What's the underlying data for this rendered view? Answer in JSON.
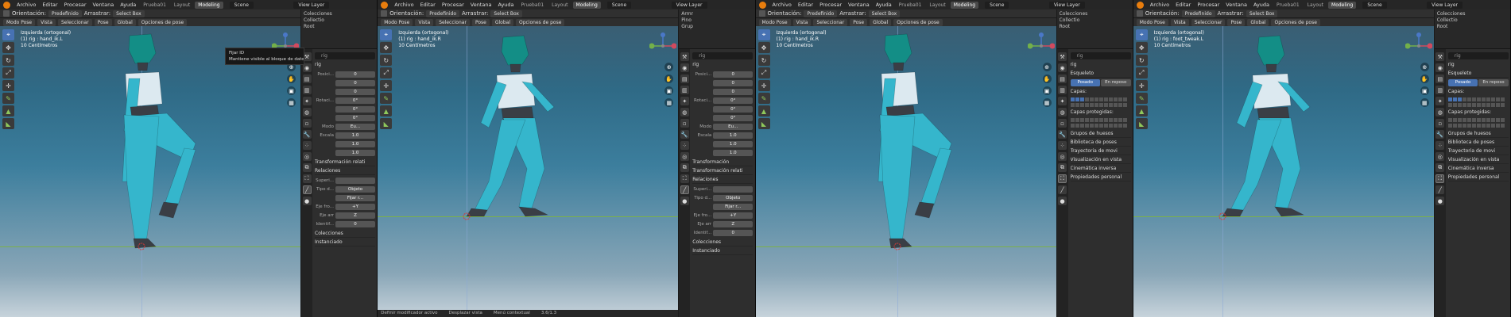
{
  "topbar": {
    "menus": [
      "Archivo",
      "Editar",
      "Procesar",
      "Ventana",
      "Ayuda"
    ],
    "workspaces": [
      "Prueba01",
      "Layout",
      "Modeling"
    ],
    "active_workspace": "Modeling",
    "scene": "Scene",
    "view_layer": "View Layer"
  },
  "header": {
    "orientation_label": "Orientación:",
    "orientation_value": "Predefinido",
    "drag_label": "Arrastrar:",
    "drag_value": "Select Box",
    "mode": "Modo Pose",
    "menus": [
      "Vista",
      "Seleccionar",
      "Pose"
    ],
    "global": "Global",
    "pose_options": "Opciones de pose"
  },
  "panels": [
    {
      "view_name": "Izquierda (ortogonal)",
      "bone": "(1) rig : hand_ik.L",
      "units": "10 Centímetros",
      "pose": "lift",
      "tooltip": [
        "Fijar ID",
        "Mantiene visible al bloque de datos actual."
      ],
      "outliner": [
        "Colecciones",
        "Collectio",
        "Root"
      ],
      "search_value": "rig",
      "header_value": "rig",
      "props_type": "transform",
      "bone_fields": [
        {
          "label": "Posici...",
          "axis": "X",
          "value": "0"
        },
        {
          "label": "",
          "axis": "Y",
          "value": "0"
        },
        {
          "label": "",
          "axis": "Z",
          "value": "0"
        },
        {
          "label": "Rotaci...",
          "axis": "X",
          "value": "0°"
        },
        {
          "label": "",
          "axis": "Y",
          "value": "0°"
        },
        {
          "label": "",
          "axis": "Z",
          "value": "0°"
        },
        {
          "label": "Modo",
          "axis": "",
          "value": "Eu..."
        },
        {
          "label": "Escala",
          "axis": "X",
          "value": "1.0"
        },
        {
          "label": "",
          "axis": "Y",
          "value": "1.0"
        },
        {
          "label": "",
          "axis": "Z",
          "value": "1.0"
        }
      ],
      "sections": [
        "Transformación relati",
        "Relaciones"
      ],
      "relation_fields": [
        {
          "label": "Superi...",
          "value": ""
        },
        {
          "label": "Tipo d...",
          "value": "Objeto"
        },
        {
          "label": "",
          "value": "Fijar r..."
        },
        {
          "label": "Eje fro...",
          "value": "+Y"
        },
        {
          "label": "Eje arr",
          "value": "Z"
        },
        {
          "label": "Identif...",
          "value": "0"
        }
      ],
      "footer_sections": [
        "Colecciones",
        "Instanciado"
      ],
      "statusbar": []
    },
    {
      "view_name": "Izquierda (ortogonal)",
      "bone": "(1) rig : hand_ik.R",
      "units": "10 Centímetros",
      "pose": "walk",
      "tooltip": [],
      "outliner": [
        "Armr",
        "Pino",
        "Grup"
      ],
      "search_value": "rig",
      "header_value": "rig",
      "props_type": "transform",
      "bone_fields": [
        {
          "label": "Posici...",
          "axis": "X",
          "value": "0"
        },
        {
          "label": "",
          "axis": "Y",
          "value": "0"
        },
        {
          "label": "",
          "axis": "Z",
          "value": "0"
        },
        {
          "label": "Rotaci...",
          "axis": "X",
          "value": "0°"
        },
        {
          "label": "",
          "axis": "Y",
          "value": "0°"
        },
        {
          "label": "",
          "axis": "Z",
          "value": "0°"
        },
        {
          "label": "Modo",
          "axis": "",
          "value": "Eu..."
        },
        {
          "label": "Escala",
          "axis": "X",
          "value": "1.0"
        },
        {
          "label": "",
          "axis": "Y",
          "value": "1.0"
        },
        {
          "label": "",
          "axis": "Z",
          "value": "1.0"
        }
      ],
      "sections": [
        "Transformación",
        "Transformación relati",
        "Relaciones"
      ],
      "relation_fields": [
        {
          "label": "Superi...",
          "value": ""
        },
        {
          "label": "Tipo d...",
          "value": "Objeto"
        },
        {
          "label": "",
          "value": "Fijar r..."
        },
        {
          "label": "Eje fro...",
          "value": "+Y"
        },
        {
          "label": "Eje arr",
          "value": "Z"
        },
        {
          "label": "Identif...",
          "value": "0"
        }
      ],
      "footer_sections": [
        "Colecciones",
        "Instanciado"
      ],
      "statusbar": [
        "Definir modificador activo",
        "Desplazar vista",
        "Menú contextual",
        "3.6/1.3"
      ]
    },
    {
      "view_name": "Izquierda (ortogonal)",
      "bone": "(1) rig : hand_ik.R",
      "units": "10 Centímetros",
      "pose": "lift",
      "tooltip": [],
      "outliner": [
        "Colecciones",
        "Collectio",
        "Root"
      ],
      "search_value": "rig",
      "header_value": "rig",
      "props_type": "skeleton",
      "skeleton_title": "Esqueleto",
      "pose_toggle": [
        "Posado",
        "En reposo"
      ],
      "layers_label": "Capas:",
      "protected_label": "Capas protegidas:",
      "sections": [
        "Grupos de huesos",
        "Biblioteca de poses",
        "Trayectoria de movi",
        "Visualización en vista",
        "Cinemática inversa",
        "Propiedades personal"
      ],
      "statusbar": []
    },
    {
      "view_name": "Izquierda (ortogonal)",
      "bone": "(1) rig : foot_tweak.L",
      "units": "10 Centímetros",
      "pose": "walk",
      "tooltip": [],
      "outliner": [
        "Colecciones",
        "Collectio",
        "Root"
      ],
      "search_value": "rig",
      "header_value": "rig",
      "props_type": "skeleton",
      "skeleton_title": "Esqueleto",
      "pose_toggle": [
        "Posado",
        "En reposo"
      ],
      "layers_label": "Capas:",
      "protected_label": "Capas protegidas:",
      "sections": [
        "Grupos de huesos",
        "Biblioteca de poses",
        "Trayectoria de movi",
        "Visualización en vista",
        "Cinemática inversa",
        "Propiedades personal"
      ],
      "statusbar": []
    }
  ],
  "colors": {
    "accent": "#4772b3",
    "body_cyan": "#35b6cc",
    "head_teal": "#138e86",
    "torso_white": "#dce9f0",
    "dark_part": "#3a3e45",
    "ground_green": "#7bb04a"
  },
  "icons": {
    "tools": [
      "cursor-icon",
      "move-icon",
      "rotate-icon",
      "scale-icon",
      "transform-icon",
      "annotate-icon",
      "measure-icon",
      "bone-roll-icon"
    ],
    "nav": [
      "zoom-icon",
      "pan-icon",
      "camera-icon",
      "grid-icon"
    ],
    "prop_tabs": [
      "tool-icon",
      "render-icon",
      "output-icon",
      "view-layer-icon",
      "scene-icon",
      "world-icon",
      "object-icon",
      "modifier-icon",
      "particles-icon",
      "physics-icon",
      "constraints-icon",
      "data-icon",
      "bone-icon",
      "material-icon"
    ]
  }
}
